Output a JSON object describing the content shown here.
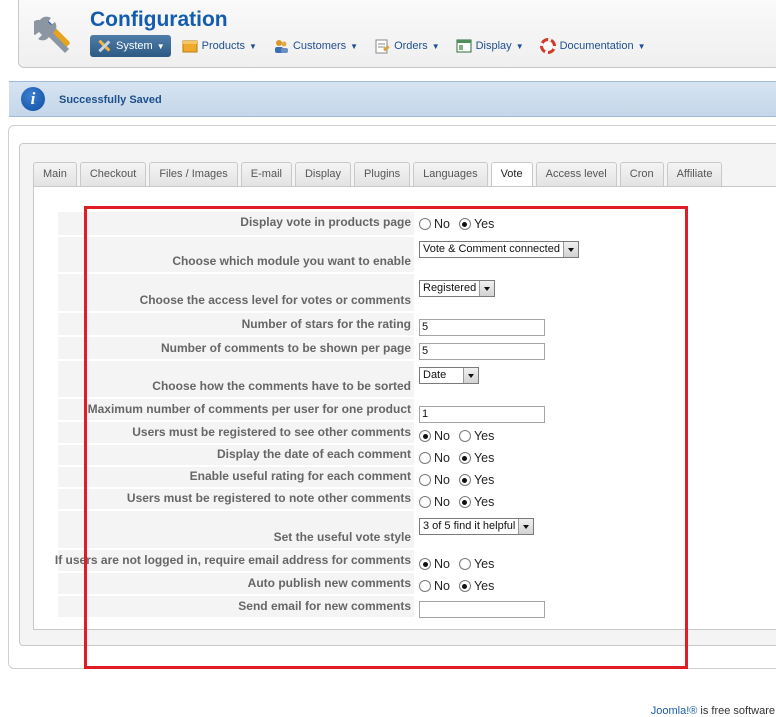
{
  "header": {
    "title": "Configuration",
    "menu": [
      {
        "label": "System",
        "icon": "wrench-icon",
        "active": true
      },
      {
        "label": "Products",
        "icon": "box-icon"
      },
      {
        "label": "Customers",
        "icon": "users-icon"
      },
      {
        "label": "Orders",
        "icon": "orders-icon"
      },
      {
        "label": "Display",
        "icon": "display-icon"
      },
      {
        "label": "Documentation",
        "icon": "lifebuoy-icon"
      }
    ]
  },
  "message": {
    "text": "Successfully Saved"
  },
  "tabs": [
    "Main",
    "Checkout",
    "Files / Images",
    "E-mail",
    "Display",
    "Plugins",
    "Languages",
    "Vote",
    "Access level",
    "Cron",
    "Affiliate"
  ],
  "active_tab": "Vote",
  "form": {
    "display_vote": {
      "label": "Display vote in products page",
      "no": "No",
      "yes": "Yes",
      "value": "Yes"
    },
    "module": {
      "label": "Choose which module you want to enable",
      "value": "Vote & Comment connected"
    },
    "access_level": {
      "label": "Choose the access level for votes or comments",
      "value": "Registered"
    },
    "stars": {
      "label": "Number of stars for the rating",
      "value": "5"
    },
    "comments_per_page": {
      "label": "Number of comments to be shown per page",
      "value": "5"
    },
    "sort": {
      "label": "Choose how the comments have to be sorted",
      "value": "Date"
    },
    "max_comments": {
      "label": "Maximum number of comments per user for one product",
      "value": "1"
    },
    "registered_see": {
      "label": "Users must be registered to see other comments",
      "no": "No",
      "yes": "Yes",
      "value": "No"
    },
    "display_date": {
      "label": "Display the date of each comment",
      "no": "No",
      "yes": "Yes",
      "value": "Yes"
    },
    "useful_rating": {
      "label": "Enable useful rating for each comment",
      "no": "No",
      "yes": "Yes",
      "value": "Yes"
    },
    "registered_note": {
      "label": "Users must be registered to note other comments",
      "no": "No",
      "yes": "Yes",
      "value": "Yes"
    },
    "useful_style": {
      "label": "Set the useful vote style",
      "value": "3 of 5 find it helpful"
    },
    "require_email": {
      "label": "If users are not logged in, require email address for comments",
      "no": "No",
      "yes": "Yes",
      "value": "No"
    },
    "auto_publish": {
      "label": "Auto publish new comments",
      "no": "No",
      "yes": "Yes",
      "value": "Yes"
    },
    "send_email": {
      "label": "Send email for new comments",
      "value": ""
    }
  },
  "footer": {
    "link": "Joomla!®",
    "text": " is free software"
  },
  "colors": {
    "title": "#135cae",
    "highlight": "#e01c24",
    "message_bg": "#d6e3f1"
  }
}
